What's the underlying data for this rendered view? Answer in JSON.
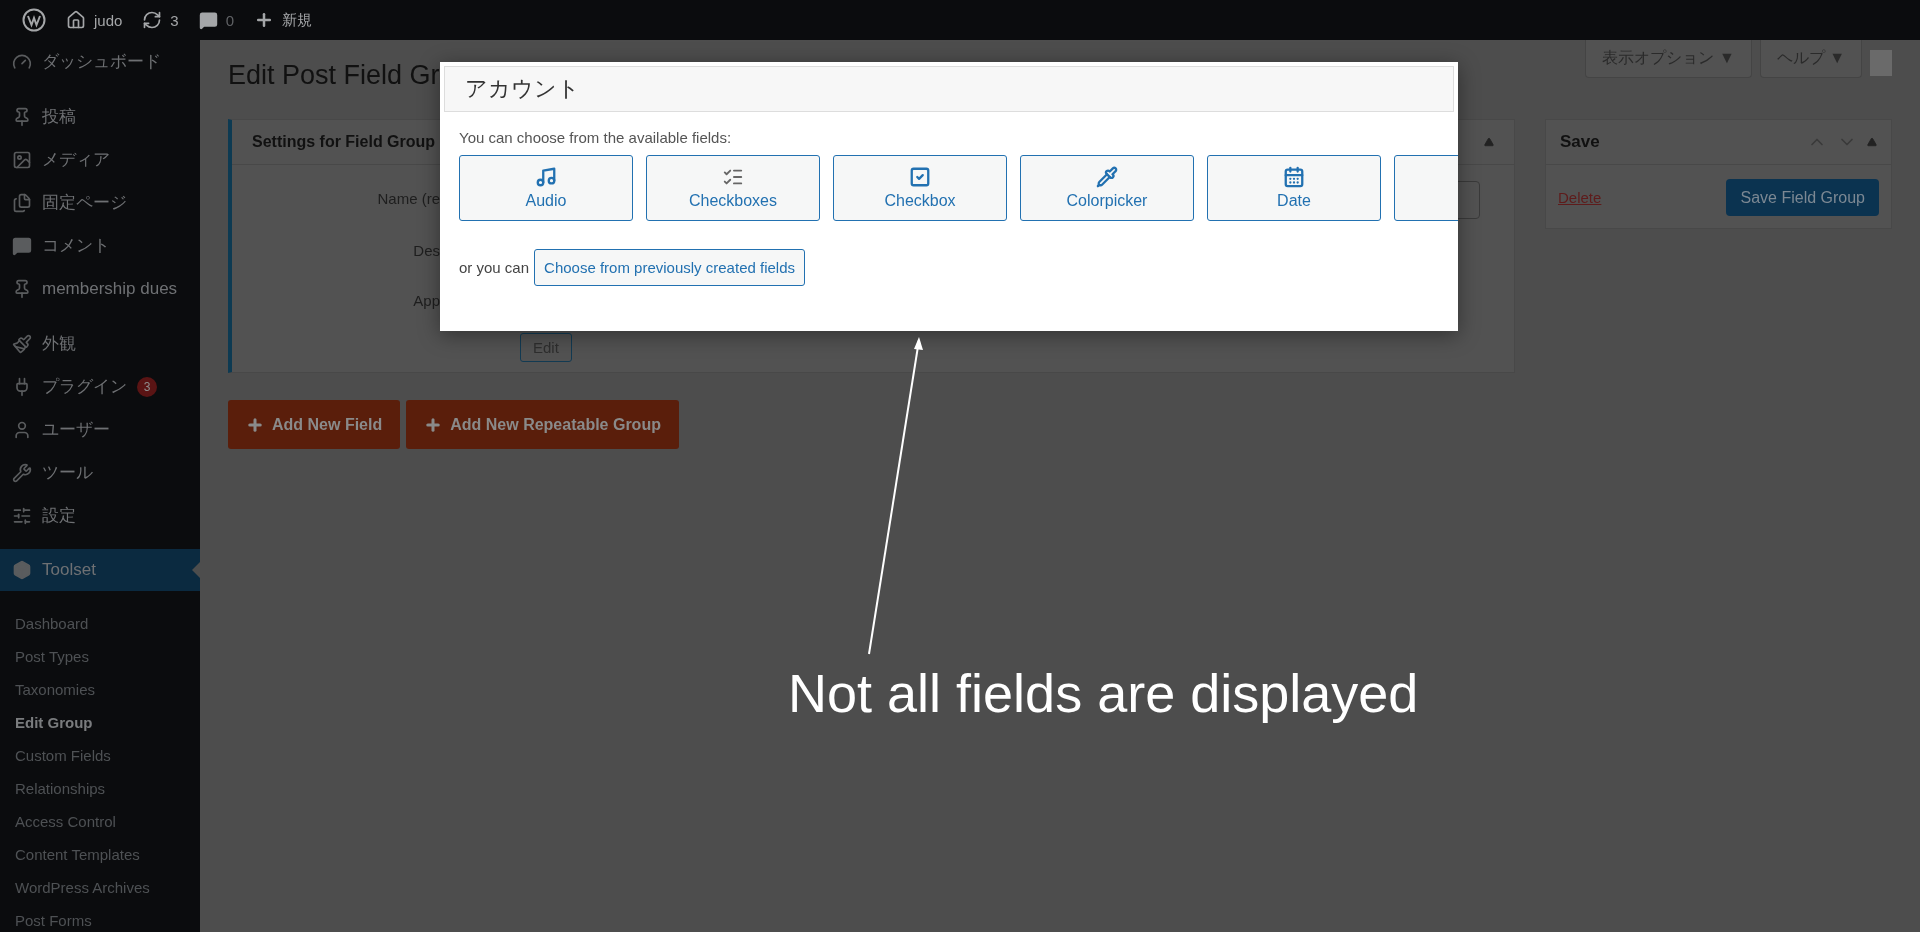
{
  "admin_bar": {
    "site": "judo",
    "updates": "3",
    "comments": "0",
    "new": "新規"
  },
  "screen_meta": [
    "表示オプション ▼",
    "ヘルプ ▼"
  ],
  "sidebar": {
    "groups": [
      [
        {
          "label": "ダッシュボード",
          "kind": "dashboard",
          "selected": false
        }
      ],
      [
        {
          "label": "投稿",
          "kind": "posts",
          "selected": false
        },
        {
          "label": "メディア",
          "kind": "media",
          "selected": false
        },
        {
          "label": "固定ページ",
          "kind": "pages",
          "selected": false
        },
        {
          "label": "コメント",
          "kind": "comments",
          "selected": false
        },
        {
          "label": "membership dues",
          "kind": "posts",
          "selected": false
        }
      ],
      [
        {
          "label": "外観",
          "kind": "appearance",
          "selected": false
        },
        {
          "label": "プラグイン",
          "kind": "plugins",
          "selected": false,
          "badge": "3"
        },
        {
          "label": "ユーザー",
          "kind": "users",
          "selected": false
        },
        {
          "label": "ツール",
          "kind": "tools",
          "selected": false
        },
        {
          "label": "設定",
          "kind": "settings",
          "selected": false
        }
      ],
      [
        {
          "label": "Toolset",
          "kind": "toolset",
          "selected": true
        }
      ]
    ],
    "submenu": [
      {
        "label": "Dashboard",
        "selected": false
      },
      {
        "label": "Post Types",
        "selected": false
      },
      {
        "label": "Taxonomies",
        "selected": false
      },
      {
        "label": "Edit Group",
        "selected": true
      },
      {
        "label": "Custom Fields",
        "selected": false
      },
      {
        "label": "Relationships",
        "selected": false
      },
      {
        "label": "Access Control",
        "selected": false
      },
      {
        "label": "Content Templates",
        "selected": false
      },
      {
        "label": "WordPress Archives",
        "selected": false
      },
      {
        "label": "Post Forms",
        "selected": false
      }
    ]
  },
  "page": {
    "title": "Edit Post Field Gr",
    "settings_panel": {
      "title": "Settings for Field Group",
      "labels": [
        "Name (re",
        "Des",
        "App"
      ],
      "edit_button": "Edit"
    },
    "buttons": [
      "Add New Field",
      "Add New Repeatable Group"
    ]
  },
  "save_box": {
    "title": "Save",
    "delete": "Delete",
    "save": "Save Field Group"
  },
  "dialog": {
    "title": "アカウント",
    "intro": "You can choose from the available fields:",
    "fields": [
      {
        "label": "Audio",
        "kind": "audio"
      },
      {
        "label": "Checkboxes",
        "kind": "checkboxes"
      },
      {
        "label": "Checkbox",
        "kind": "checkbox"
      },
      {
        "label": "Colorpicker",
        "kind": "colorpicker"
      },
      {
        "label": "Date",
        "kind": "date"
      },
      {
        "kind": "cut"
      }
    ],
    "or_text": "or you can",
    "choose_button": "Choose from previously created fields"
  },
  "annotation": {
    "text": "Not all fields are displayed"
  }
}
